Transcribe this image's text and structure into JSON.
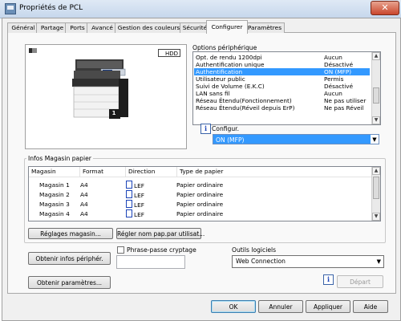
{
  "window": {
    "title": "Propriétés de PCL",
    "close_label": "✕"
  },
  "tabs": [
    {
      "label": "Général"
    },
    {
      "label": "Partage"
    },
    {
      "label": "Ports"
    },
    {
      "label": "Avancé"
    },
    {
      "label": "Gestion des couleurs"
    },
    {
      "label": "Sécurité"
    },
    {
      "label": "Configurer",
      "active": true
    },
    {
      "label": "Paramètres"
    }
  ],
  "preview": {
    "hdd_label": "HDD",
    "tray_badge": "1"
  },
  "options": {
    "group_label": "Options périphérique",
    "rows": [
      {
        "name": "Opt. de rendu 1200dpi",
        "value": "Aucun"
      },
      {
        "name": "Authentification unique",
        "value": "Désactivé"
      },
      {
        "name": "Authentification",
        "value": "ON (MFP)",
        "selected": true
      },
      {
        "name": "Utilisateur public",
        "value": "Permis"
      },
      {
        "name": "Suivi de Volume (E.K.C)",
        "value": "Désactivé"
      },
      {
        "name": "LAN sans fil",
        "value": "Aucun"
      },
      {
        "name": "Réseau Étendu(Fonctionnement)",
        "value": "Ne pas utiliser"
      },
      {
        "name": "Réseau Étendu(Réveil depuis ErP)",
        "value": "Ne pas Réveil"
      }
    ]
  },
  "configur": {
    "label": "Configur.",
    "value": "ON (MFP)"
  },
  "trays": {
    "group_label": "Infos Magasin papier",
    "columns": [
      "Magasin",
      "Format",
      "Direction",
      "Type de papier"
    ],
    "rows": [
      {
        "tray": "Magasin 1",
        "format": "A4",
        "direction": "LEF",
        "type": "Papier ordinaire"
      },
      {
        "tray": "Magasin 2",
        "format": "A4",
        "direction": "LEF",
        "type": "Papier ordinaire"
      },
      {
        "tray": "Magasin 3",
        "format": "A4",
        "direction": "LEF",
        "type": "Papier ordinaire"
      },
      {
        "tray": "Magasin 4",
        "format": "A4",
        "direction": "LEF",
        "type": "Papier ordinaire"
      }
    ],
    "settings_button": "Réglages magasin...",
    "set_paper_name_button": "Régler nom pap.par utilisat..."
  },
  "actions": {
    "get_info_button": "Obtenir infos périphér.",
    "get_settings_button": "Obtenir paramètres...",
    "passphrase_label": "Phrase-passe cryptage",
    "passphrase_value": "",
    "tools_label": "Outils logiciels",
    "tools_value": "Web Connection",
    "start_button": "Départ"
  },
  "footer": {
    "ok": "OK",
    "cancel": "Annuler",
    "apply": "Appliquer",
    "help": "Aide"
  }
}
